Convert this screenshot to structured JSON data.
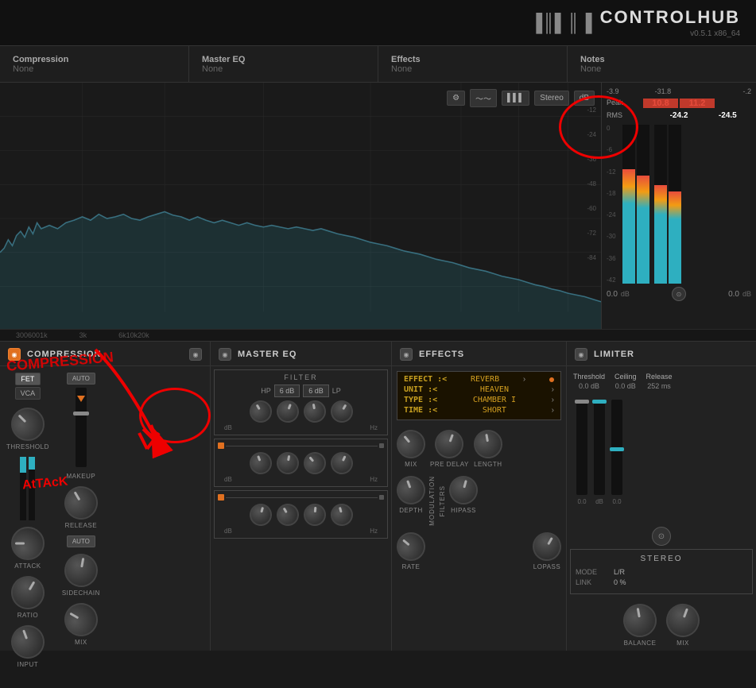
{
  "app": {
    "title": "CONTROLHUB",
    "version": "v0.5.1 x86_64"
  },
  "nav": {
    "items": [
      {
        "label": "Compression",
        "value": "None"
      },
      {
        "label": "Master EQ",
        "value": "None"
      },
      {
        "label": "Effects",
        "value": "None"
      },
      {
        "label": "Notes",
        "value": "None"
      }
    ]
  },
  "spectrum": {
    "db_labels": [
      "-12",
      "-24",
      "-36",
      "-48",
      "-60",
      "-72",
      "-84"
    ],
    "x_labels": [
      "300",
      "600",
      "1k",
      "3k",
      "6k",
      "10k",
      "20k"
    ],
    "stereo_label": "Stereo",
    "db_unit": "dB"
  },
  "meters": {
    "peak_label": "Peak",
    "rms_label": "RMS",
    "peak_left": "10.8",
    "peak_right": "11.2",
    "rms_left": "-24.2",
    "rms_right": "-24.5",
    "left_val": "-31.8",
    "right_val": "-3.9",
    "bottom_left": "0.0",
    "bottom_right": "0.0",
    "db_bottom": "dB",
    "db_bottom2": "dB",
    "scale": [
      "0",
      "-6",
      "-12",
      "-18",
      "-24",
      "-30",
      "-36",
      "-42"
    ]
  },
  "compression": {
    "title": "COMPRESSION",
    "type_fet": "FET",
    "type_vca": "VCA",
    "auto_label": "AUTO",
    "makeup_label": "MAKEUP",
    "threshold_label": "THRESHOLD",
    "attack_label": "ATTACK",
    "ratio_label": "RATIO",
    "input_label": "INPUT",
    "release_label": "RELEASE",
    "sidechain_label": "SIDECHAIN",
    "mix_label": "MIX",
    "auto_comp_label": "AUTO"
  },
  "mastereq": {
    "title": "MASTER EQ",
    "filter_title": "FILTER",
    "hp_label": "HP",
    "lp_label": "LP",
    "btn_6db_1": "6 dB",
    "btn_6db_2": "6 dB",
    "db_label": "dB",
    "hz_label": "Hz",
    "db_label2": "dB",
    "hz_label2": "Hz",
    "db_label3": "dB",
    "hz_label3": "Hz"
  },
  "effects": {
    "title": "EFFECTS",
    "lines": [
      {
        "key": "EFFECT",
        "sep": ":<",
        "val": "REVERB"
      },
      {
        "key": "UNIT",
        "sep": ":<",
        "val": "HEAVEN"
      },
      {
        "key": "TYPE",
        "sep": ":<",
        "val": "CHAMBER I"
      },
      {
        "key": "TIME",
        "sep": ":<",
        "val": "SHORT"
      }
    ],
    "mix_label": "MIX",
    "pre_delay_label": "PRE DELAY",
    "length_label": "LENGTH",
    "depth_label": "DEPTH",
    "modulation_label": "MODULATION",
    "filters_label": "FILTERS",
    "hipass_label": "HIPASS",
    "lopass_label": "LOPASS",
    "rate_label": "RATE"
  },
  "limiter": {
    "title": "LIMITER",
    "threshold_label": "Threshold",
    "threshold_val": "0.0 dB",
    "ceiling_label": "Ceiling",
    "ceiling_val": "0.0 dB",
    "release_label": "Release",
    "release_val": "252 ms",
    "link_icon": "⊙",
    "stereo_title": "STEREO",
    "mode_label": "MODE",
    "mode_val": "L/R",
    "link_label": "LINK",
    "link_val": "0 %",
    "balance_label": "BALANCE",
    "mix_label": "MIX",
    "bottom_left": "0.0",
    "bottom_right": "0.0",
    "db_label": "dB",
    "db_label2": "dB"
  },
  "annotations": {
    "attack_label": "AtTAcK",
    "compression_label": "COMPRESSION"
  }
}
